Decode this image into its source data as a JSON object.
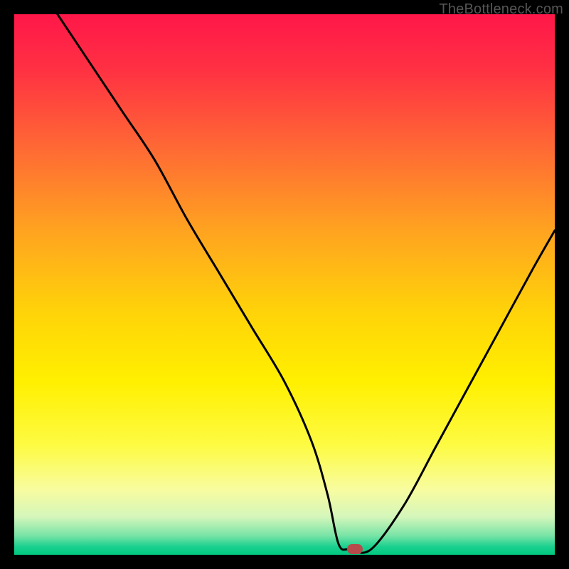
{
  "attribution": "TheBottleneck.com",
  "chart_data": {
    "type": "line",
    "title": "",
    "xlabel": "",
    "ylabel": "",
    "xlim": [
      0,
      100
    ],
    "ylim": [
      0,
      100
    ],
    "series": [
      {
        "name": "bottleneck-curve",
        "x": [
          8,
          14,
          20,
          26,
          32,
          38,
          44,
          50,
          55,
          58,
          60,
          62,
          66,
          72,
          78,
          84,
          90,
          96,
          100
        ],
        "y": [
          100,
          91,
          82,
          73,
          62,
          52,
          42,
          32,
          21,
          11,
          2,
          1,
          1,
          9,
          20,
          31,
          42,
          53,
          60
        ]
      }
    ],
    "marker": {
      "x": 63,
      "y": 1
    },
    "background_gradient": {
      "stops": [
        {
          "offset": 0.0,
          "color": "#ff1749"
        },
        {
          "offset": 0.1,
          "color": "#ff3043"
        },
        {
          "offset": 0.25,
          "color": "#ff6a34"
        },
        {
          "offset": 0.4,
          "color": "#ffa320"
        },
        {
          "offset": 0.55,
          "color": "#ffd309"
        },
        {
          "offset": 0.68,
          "color": "#fff000"
        },
        {
          "offset": 0.8,
          "color": "#fdfb45"
        },
        {
          "offset": 0.88,
          "color": "#f8fca0"
        },
        {
          "offset": 0.93,
          "color": "#d4f6bb"
        },
        {
          "offset": 0.965,
          "color": "#77e4a6"
        },
        {
          "offset": 0.985,
          "color": "#1ad08f"
        },
        {
          "offset": 1.0,
          "color": "#00c97f"
        }
      ]
    }
  }
}
